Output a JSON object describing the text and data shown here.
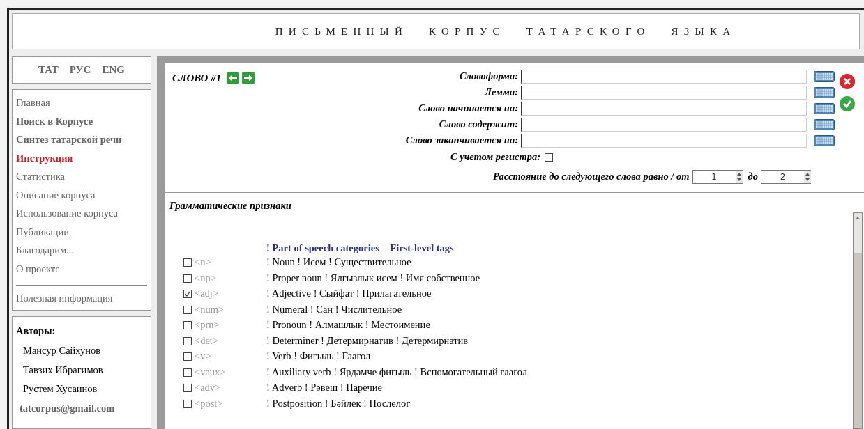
{
  "header": {
    "title": "ПИСЬМЕННЫЙ КОРПУС ТАТАРСКОГО ЯЗЫКА"
  },
  "languages": [
    {
      "label": "ТАТ"
    },
    {
      "label": "РУС"
    },
    {
      "label": "ENG"
    }
  ],
  "nav": [
    {
      "label": "Главная",
      "kind": "plain",
      "selected": false
    },
    {
      "label": "Поиск в Корпусе",
      "kind": "bold",
      "selected": false
    },
    {
      "label": "Синтез татарской речи",
      "kind": "bold",
      "selected": false
    },
    {
      "label": "Инструкция",
      "kind": "bold",
      "selected": true
    },
    {
      "label": "Статистика",
      "kind": "plain",
      "selected": false
    },
    {
      "label": "Описание корпуса",
      "kind": "plain",
      "selected": false
    },
    {
      "label": "Использование корпуса",
      "kind": "plain",
      "selected": false
    },
    {
      "label": "Публикации",
      "kind": "plain",
      "selected": false
    },
    {
      "label": "Благодарим...",
      "kind": "plain",
      "selected": false
    },
    {
      "label": "О проекте",
      "kind": "plain",
      "selected": false
    }
  ],
  "nav_extra": "Полезная информация",
  "authors": {
    "title": "Авторы:",
    "names": [
      "Мансур Сайхунов",
      "Тавзих Ибрагимов",
      "Рустем Хусаинов"
    ],
    "email": "tatcorpus@gmail.com"
  },
  "word": {
    "title": "СЛОВО #1",
    "fields": [
      {
        "label": "Словоформа:"
      },
      {
        "label": "Лемма:"
      },
      {
        "label": "Слово начинается на:"
      },
      {
        "label": "Слово содержит:"
      },
      {
        "label": "Слово заканчивается на:"
      }
    ],
    "case_sensitive": {
      "label": "С учетом регистра:",
      "checked": false
    },
    "distance": {
      "label": "Расстояние до следующего слова равно / от",
      "from": "1",
      "to_label": "до",
      "to": "2"
    }
  },
  "grammar": {
    "title": "Грамматические признаки",
    "group": "! Part of speech categories = First-level tags",
    "tags": [
      {
        "tag": "<n>",
        "description": "! Noun ! Исем ! Существительное",
        "checked": false
      },
      {
        "tag": "<np>",
        "description": "! Proper noun ! Ялгызлык исем ! Имя собственное",
        "checked": false
      },
      {
        "tag": "<adj>",
        "description": "! Adjective ! Сыйфат ! Прилагательное",
        "checked": true
      },
      {
        "tag": "<num>",
        "description": "! Numeral ! Сан ! Числительное",
        "checked": false
      },
      {
        "tag": "<prn>",
        "description": "! Pronoun ! Алмашлык ! Местоимение",
        "checked": false
      },
      {
        "tag": "<det>",
        "description": "! Determiner ! Детермирнатив ! Детермирнатив",
        "checked": false
      },
      {
        "tag": "<v>",
        "description": "! Verb ! Фигыль ! Глагол",
        "checked": false
      },
      {
        "tag": "<vaux>",
        "description": "! Auxiliary verb ! Ярдәмче фигыль ! Вспомогательный глагол",
        "checked": false
      },
      {
        "tag": "<adv>",
        "description": "! Adverb ! Рәвеш ! Наречие",
        "checked": false
      },
      {
        "tag": "<post>",
        "description": "! Postposition ! Бәйлек ! Послелог",
        "checked": false
      }
    ]
  }
}
